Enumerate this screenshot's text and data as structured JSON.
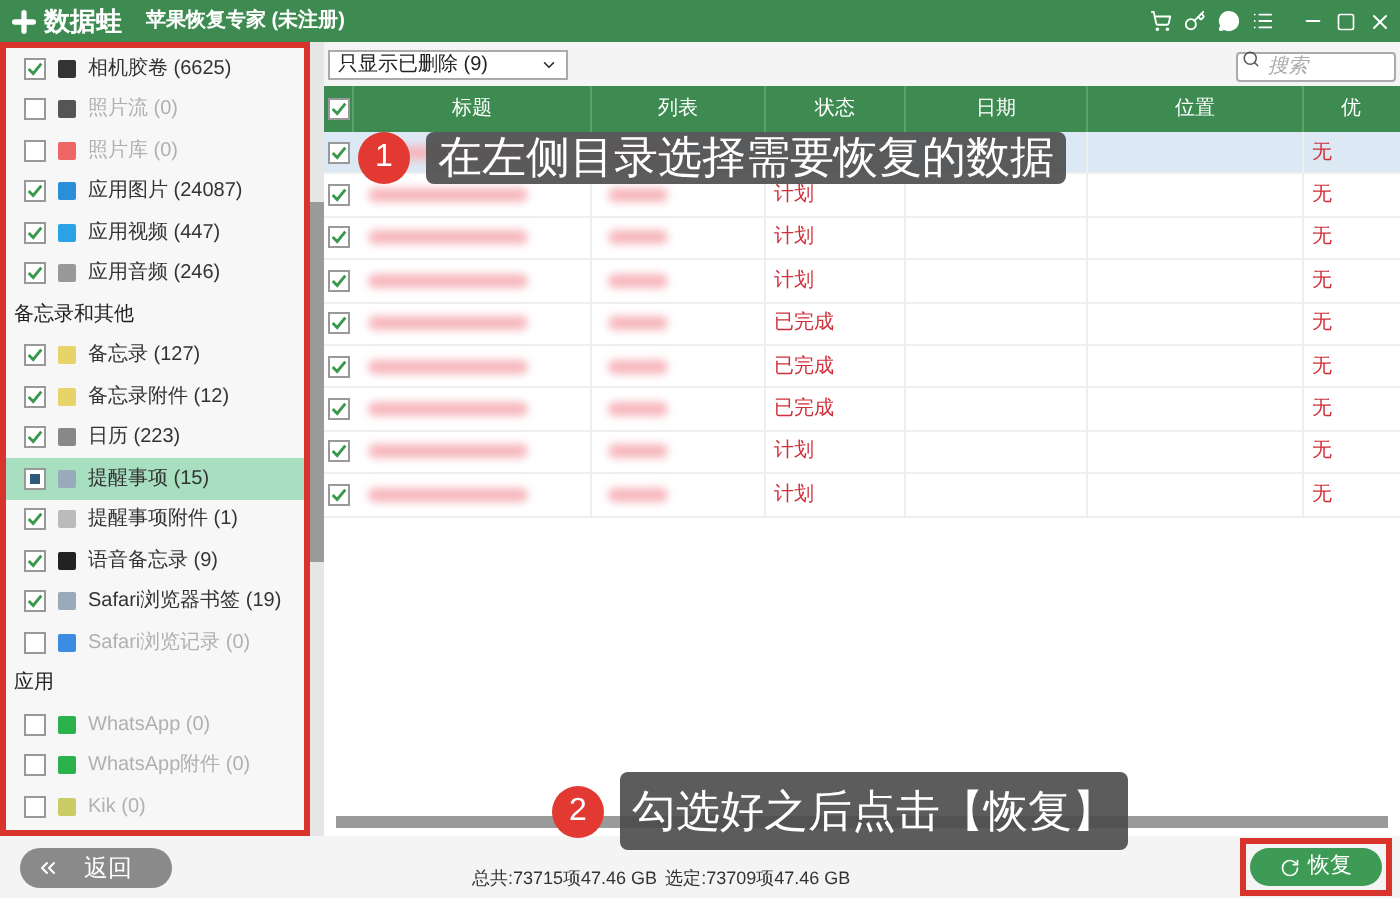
{
  "window": {
    "logo": "数据蛙",
    "title": "苹果恢复专家 (未注册)"
  },
  "sidebar": {
    "sections": [
      {
        "items": [
          {
            "label": "相机胶卷 (6625)",
            "checked": true,
            "partial": false,
            "disabled": false,
            "selected": false
          },
          {
            "label": "照片流 (0)",
            "checked": false,
            "partial": false,
            "disabled": true,
            "selected": false
          },
          {
            "label": "照片库 (0)",
            "checked": false,
            "partial": false,
            "disabled": true,
            "selected": false
          },
          {
            "label": "应用图片 (24087)",
            "checked": true,
            "partial": false,
            "disabled": false,
            "selected": false
          },
          {
            "label": "应用视频 (447)",
            "checked": true,
            "partial": false,
            "disabled": false,
            "selected": false
          },
          {
            "label": "应用音频 (246)",
            "checked": true,
            "partial": false,
            "disabled": false,
            "selected": false
          }
        ]
      },
      {
        "title": "备忘录和其他",
        "items": [
          {
            "label": "备忘录 (127)",
            "checked": true,
            "partial": false,
            "disabled": false,
            "selected": false
          },
          {
            "label": "备忘录附件 (12)",
            "checked": true,
            "partial": false,
            "disabled": false,
            "selected": false
          },
          {
            "label": "日历 (223)",
            "checked": true,
            "partial": false,
            "disabled": false,
            "selected": false
          },
          {
            "label": "提醒事项 (15)",
            "checked": false,
            "partial": true,
            "disabled": false,
            "selected": true
          },
          {
            "label": "提醒事项附件 (1)",
            "checked": true,
            "partial": false,
            "disabled": false,
            "selected": false
          },
          {
            "label": "语音备忘录 (9)",
            "checked": true,
            "partial": false,
            "disabled": false,
            "selected": false
          },
          {
            "label": "Safari浏览器书签 (19)",
            "checked": true,
            "partial": false,
            "disabled": false,
            "selected": false
          },
          {
            "label": "Safari浏览记录 (0)",
            "checked": false,
            "partial": false,
            "disabled": true,
            "selected": false
          }
        ]
      },
      {
        "title": "应用",
        "items": [
          {
            "label": "WhatsApp (0)",
            "checked": false,
            "partial": false,
            "disabled": true,
            "selected": false
          },
          {
            "label": "WhatsApp附件 (0)",
            "checked": false,
            "partial": false,
            "disabled": true,
            "selected": false
          },
          {
            "label": "Kik (0)",
            "checked": false,
            "partial": false,
            "disabled": true,
            "selected": false
          }
        ]
      }
    ]
  },
  "toolbar": {
    "filter": "只显示已删除 (9)",
    "search": {
      "placeholder": "搜索"
    }
  },
  "table": {
    "all_checked": true,
    "columns": [
      "标题",
      "列表",
      "状态",
      "日期",
      "位置",
      "优"
    ],
    "rows": [
      {
        "checked": true,
        "selected": true,
        "priority": "无"
      },
      {
        "checked": true,
        "selected": false,
        "status": "计划",
        "priority": "无"
      },
      {
        "checked": true,
        "selected": false,
        "status": "计划",
        "priority": "无"
      },
      {
        "checked": true,
        "selected": false,
        "status": "计划",
        "priority": "无"
      },
      {
        "checked": true,
        "selected": false,
        "status": "已完成",
        "priority": "无"
      },
      {
        "checked": true,
        "selected": false,
        "status": "已完成",
        "priority": "无"
      },
      {
        "checked": true,
        "selected": false,
        "status": "已完成",
        "priority": "无"
      },
      {
        "checked": true,
        "selected": false,
        "status": "计划",
        "priority": "无"
      },
      {
        "checked": true,
        "selected": false,
        "status": "计划",
        "priority": "无"
      }
    ]
  },
  "callouts": [
    {
      "number": "1",
      "text": "在左侧目录选择需要恢复的数据"
    },
    {
      "number": "2",
      "text": "勾选好之后点击【恢复】"
    }
  ],
  "status_bar": {
    "total": "总共:73715项47.46 GB",
    "selected": "选定:73709项47.46 GB"
  },
  "buttons": {
    "back": "返回",
    "restore": "恢复"
  }
}
